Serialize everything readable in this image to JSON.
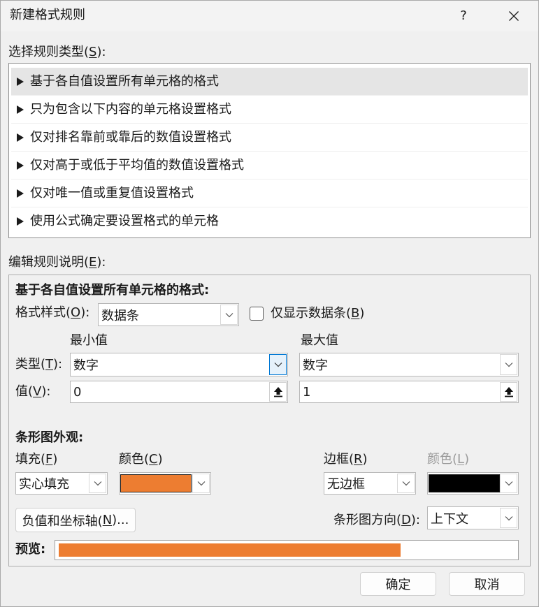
{
  "title_bar": {
    "title": "新建格式规则",
    "help_glyph": "?"
  },
  "rule_types": {
    "label": {
      "pre": "选择规则类型(",
      "key": "S",
      "post": "):"
    },
    "items": [
      {
        "label": "基于各自值设置所有单元格的格式",
        "selected": true
      },
      {
        "label": "只为包含以下内容的单元格设置格式",
        "selected": false
      },
      {
        "label": "仅对排名靠前或靠后的数值设置格式",
        "selected": false
      },
      {
        "label": "仅对高于或低于平均值的数值设置格式",
        "selected": false
      },
      {
        "label": "仅对唯一值或重复值设置格式",
        "selected": false
      },
      {
        "label": "使用公式确定要设置格式的单元格",
        "selected": false
      }
    ]
  },
  "rule_description": {
    "label": {
      "pre": "编辑规则说明(",
      "key": "E",
      "post": "):"
    },
    "heading": "基于各自值设置所有单元格的格式:",
    "format_style": {
      "label": {
        "pre": "格式样式(",
        "key": "O",
        "post": "):"
      },
      "value": "数据条"
    },
    "show_bar_only": {
      "label": {
        "pre": "仅显示数据条(",
        "key": "B",
        "post": ")"
      },
      "checked": false
    },
    "min_header": "最小值",
    "max_header": "最大值",
    "type_label": {
      "pre": "类型(",
      "key": "T",
      "post": "):"
    },
    "value_label": {
      "pre": "值(",
      "key": "V",
      "post": "):"
    },
    "minimum": {
      "type": "数字",
      "value": "0"
    },
    "maximum": {
      "type": "数字",
      "value": "1"
    },
    "bar_appearance": {
      "heading": "条形图外观:",
      "fill_label": {
        "pre": "填充(",
        "key": "F",
        "post": ")"
      },
      "fill_value": "实心填充",
      "fill_color_label": {
        "pre": "颜色(",
        "key": "C",
        "post": ")"
      },
      "fill_color": "#ED7D31",
      "border_label": {
        "pre": "边框(",
        "key": "R",
        "post": ")"
      },
      "border_value": "无边框",
      "border_color_label": {
        "pre": "颜色(",
        "key": "L",
        "post": ")"
      },
      "border_color": "#000000",
      "border_color_enabled": false,
      "negative_axis_button": {
        "pre": "负值和坐标轴(",
        "key": "N",
        "post": ")..."
      },
      "direction_label": {
        "pre": "条形图方向(",
        "key": "D",
        "post": "):"
      },
      "direction_value": "上下文"
    },
    "preview": {
      "label": "预览:",
      "fill_fraction": 0.75
    }
  },
  "footer": {
    "ok_label": "确定",
    "cancel_label": "取消"
  },
  "ui_colors": {
    "focus_accent": "#0078D4",
    "selection": "#E5E5E5"
  }
}
